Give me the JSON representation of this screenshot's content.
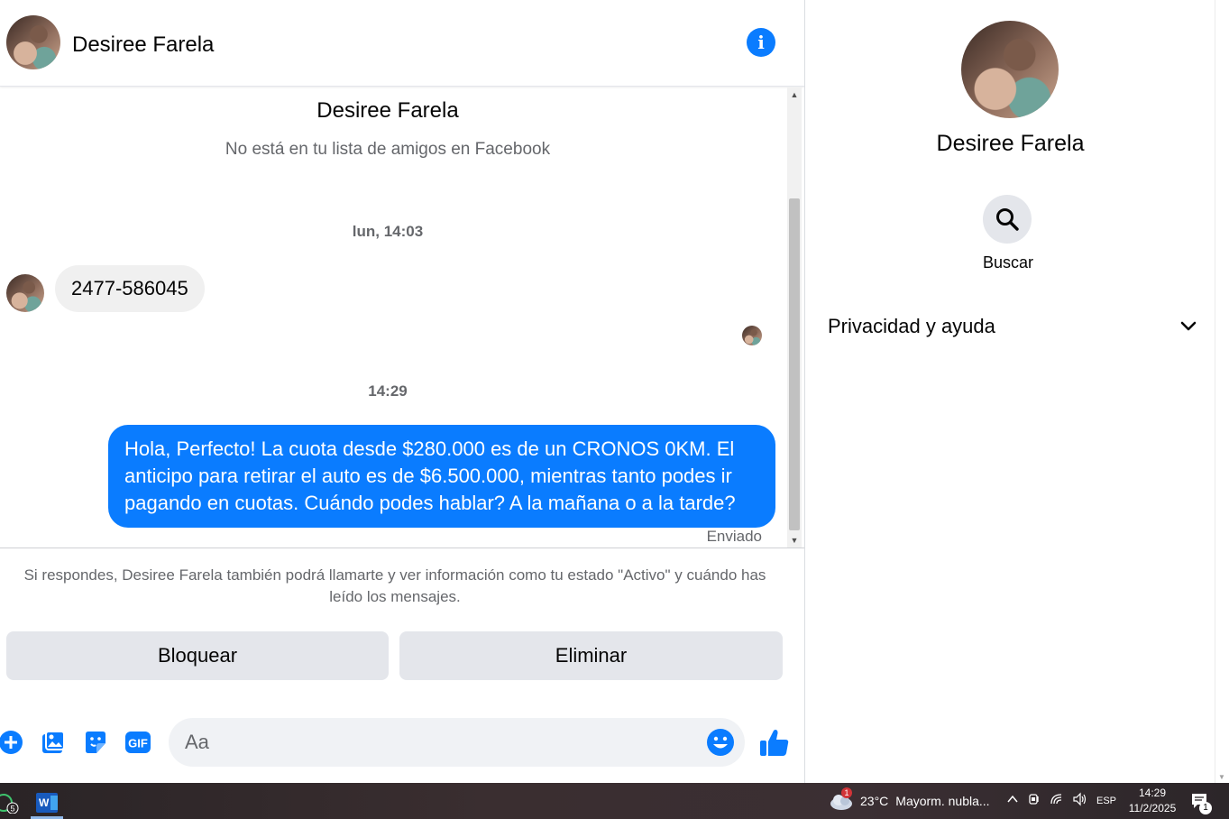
{
  "contact": {
    "name": "Desiree Farela",
    "subtitle": "No está en tu lista de amigos en Facebook"
  },
  "messages": [
    {
      "type": "timestamp",
      "text": "lun, 14:03"
    },
    {
      "type": "incoming",
      "text": "2477-586045"
    },
    {
      "type": "timestamp",
      "text": "14:29"
    },
    {
      "type": "outgoing",
      "text": "Hola, Perfecto! La cuota desde $280.000 es de un CRONOS 0KM. El anticipo para retirar el auto es de $6.500.000, mientras tanto podes ir pagando en cuotas. Cuándo podes hablar? A la mañana o a la tarde?",
      "status": "Enviado"
    }
  ],
  "notice": "Si respondes, Desiree Farela también podrá llamarte y ver información como tu estado \"Activo\" y cuándo has leído los mensajes.",
  "actions": {
    "block": "Bloquear",
    "delete": "Eliminar"
  },
  "composer": {
    "placeholder": "Aa",
    "gif_label": "GIF"
  },
  "right_panel": {
    "search_label": "Buscar",
    "section": "Privacidad y ayuda"
  },
  "taskbar": {
    "badge_count": "5",
    "weather_temp": "23°C",
    "weather_desc": "Mayorm. nubla...",
    "weather_alert": "1",
    "language": "ESP",
    "time": "14:29",
    "date": "11/2/2025",
    "notifications": "1"
  },
  "colors": {
    "accent": "#0a7cff",
    "bubble_in": "#f0f0f0",
    "button_bg": "#e4e6eb"
  }
}
